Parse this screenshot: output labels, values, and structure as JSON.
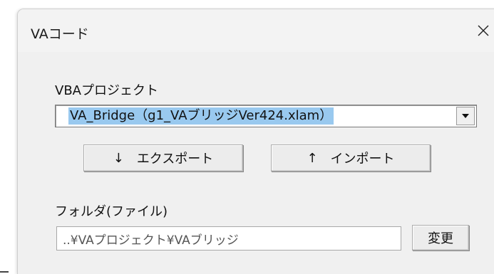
{
  "window": {
    "title": "VAコード",
    "close_glyph": "✕"
  },
  "project": {
    "label": "VBAプロジェクト",
    "selected": "VA_Bridge（g1_VAブリッジVer424.xlam）",
    "dropdown_icon": "chevron-down-icon"
  },
  "buttons": {
    "export": {
      "arrow": "↓",
      "label": "エクスポート"
    },
    "import": {
      "arrow": "↑",
      "label": "インポート"
    },
    "change": {
      "label": "変更"
    }
  },
  "folder": {
    "label": "フォルダ(ファイル)",
    "value": "..¥VAプロジェクト¥VAブリッジ"
  }
}
